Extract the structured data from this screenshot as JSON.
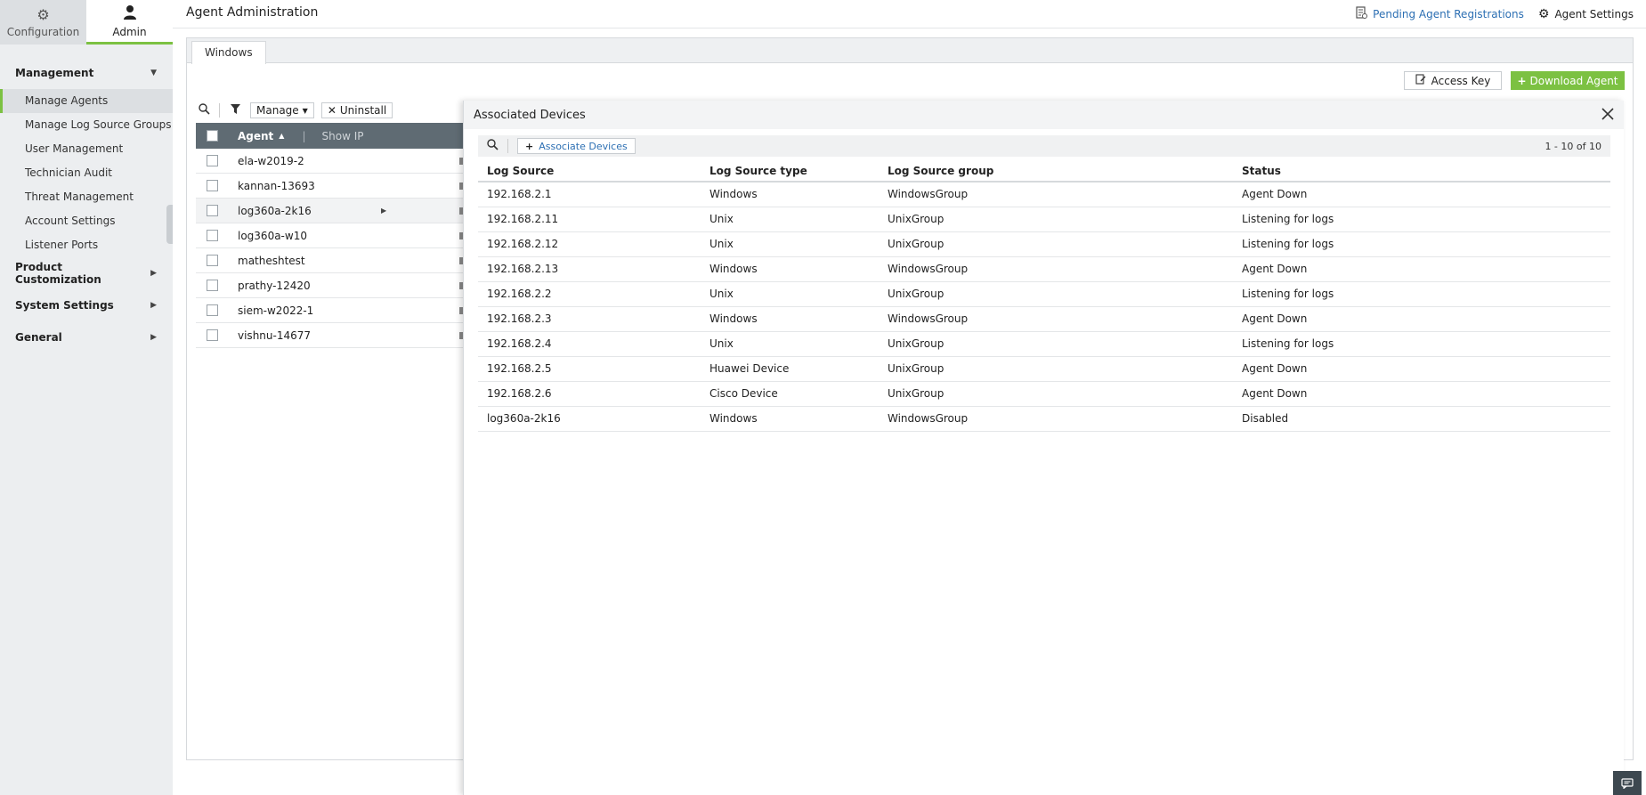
{
  "sidebar": {
    "top_tabs": [
      {
        "label": "Configuration",
        "icon": "gear-icon"
      },
      {
        "label": "Admin",
        "icon": "user-icon"
      }
    ],
    "management_label": "Management",
    "management_items": [
      {
        "label": "Manage Agents"
      },
      {
        "label": "Manage Log Source Groups"
      },
      {
        "label": "User Management"
      },
      {
        "label": "Technician Audit"
      },
      {
        "label": "Threat Management"
      },
      {
        "label": "Account Settings"
      },
      {
        "label": "Listener Ports"
      }
    ],
    "product_customization_label": "Product Customization",
    "system_settings_label": "System Settings",
    "general_label": "General"
  },
  "header": {
    "title": "Agent Administration",
    "pending_link": "Pending Agent Registrations",
    "agent_settings": "Agent Settings"
  },
  "main": {
    "tab_label": "Windows",
    "access_key_label": "Access Key",
    "download_agent_label": "Download Agent"
  },
  "agents": {
    "manage_label": "Manage",
    "uninstall_label": "Uninstall",
    "col_agent": "Agent",
    "show_ip": "Show IP",
    "rows": [
      {
        "name": "ela-w2019-2"
      },
      {
        "name": "kannan-13693"
      },
      {
        "name": "log360a-2k16"
      },
      {
        "name": "log360a-w10"
      },
      {
        "name": "matheshtest"
      },
      {
        "name": "prathy-12420"
      },
      {
        "name": "siem-w2022-1"
      },
      {
        "name": "vishnu-14677"
      }
    ]
  },
  "overlay": {
    "title": "Associated Devices",
    "associate_label": "Associate Devices",
    "pager": "1 - 10 of 10",
    "columns": {
      "log_source": "Log Source",
      "type": "Log Source type",
      "group": "Log Source group",
      "status": "Status"
    },
    "rows": [
      {
        "source": "192.168.2.1",
        "type": "Windows",
        "group": "WindowsGroup",
        "status": "Agent Down"
      },
      {
        "source": "192.168.2.11",
        "type": "Unix",
        "group": "UnixGroup",
        "status": "Listening for logs"
      },
      {
        "source": "192.168.2.12",
        "type": "Unix",
        "group": "UnixGroup",
        "status": "Listening for logs"
      },
      {
        "source": "192.168.2.13",
        "type": "Windows",
        "group": "WindowsGroup",
        "status": "Agent Down"
      },
      {
        "source": "192.168.2.2",
        "type": "Unix",
        "group": "UnixGroup",
        "status": "Listening for logs"
      },
      {
        "source": "192.168.2.3",
        "type": "Windows",
        "group": "WindowsGroup",
        "status": "Agent Down"
      },
      {
        "source": "192.168.2.4",
        "type": "Unix",
        "group": "UnixGroup",
        "status": "Listening for logs"
      },
      {
        "source": "192.168.2.5",
        "type": "Huawei Device",
        "group": "UnixGroup",
        "status": "Agent Down"
      },
      {
        "source": "192.168.2.6",
        "type": "Cisco Device",
        "group": "UnixGroup",
        "status": "Agent Down"
      },
      {
        "source": "log360a-2k16",
        "type": "Windows",
        "group": "WindowsGroup",
        "status": "Disabled"
      }
    ]
  },
  "colors": {
    "accent_green": "#7cc142",
    "link_blue": "#2c6fb3",
    "status_down": "#d9532c",
    "status_listening": "#4a9a2a",
    "table_header": "#5f6b73"
  }
}
